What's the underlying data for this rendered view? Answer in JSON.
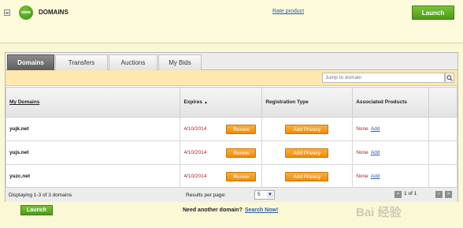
{
  "header": {
    "logo_text": "www",
    "title": "DOMAINS",
    "rate_link": "Rate product",
    "launch_label": "Launch"
  },
  "tabs": [
    {
      "label": "Domains",
      "active": true
    },
    {
      "label": "Transfers",
      "active": false
    },
    {
      "label": "Auctions",
      "active": false
    },
    {
      "label": "My Bids",
      "active": false
    }
  ],
  "search": {
    "placeholder": "Jump to domain",
    "icon": "magnifier-icon"
  },
  "table": {
    "columns": {
      "name": "My Domains",
      "expires": "Expires",
      "registration": "Registration Type",
      "associated": "Associated Products"
    },
    "rows": [
      {
        "domain": "yujk.net",
        "expires": "4/10/2014",
        "renew": "Renew",
        "privacy": "Add Privacy",
        "associated": "None",
        "add": "Add"
      },
      {
        "domain": "yujs.net",
        "expires": "4/10/2014",
        "renew": "Renew",
        "privacy": "Add Privacy",
        "associated": "None",
        "add": "Add"
      },
      {
        "domain": "yuzc.net",
        "expires": "4/10/2014",
        "renew": "Renew",
        "privacy": "Add Privacy",
        "associated": "None",
        "add": "Add"
      }
    ]
  },
  "footer": {
    "displaying": "Displaying 1-3 of 3 domains",
    "results_label": "Results per page:",
    "results_value": "5",
    "pager_text": "1 of 1"
  },
  "bottom": {
    "launch_label": "Launch",
    "need_text": "Need another domain?",
    "search_now": "Search Now!"
  },
  "watermark": "Bai 经验",
  "colors": {
    "accent_green": "#5aa51f",
    "action_orange": "#f39c1a",
    "expiry_red": "#b0212a",
    "link_blue": "#2c5fa5",
    "header_bg": "#fdfbdc"
  }
}
